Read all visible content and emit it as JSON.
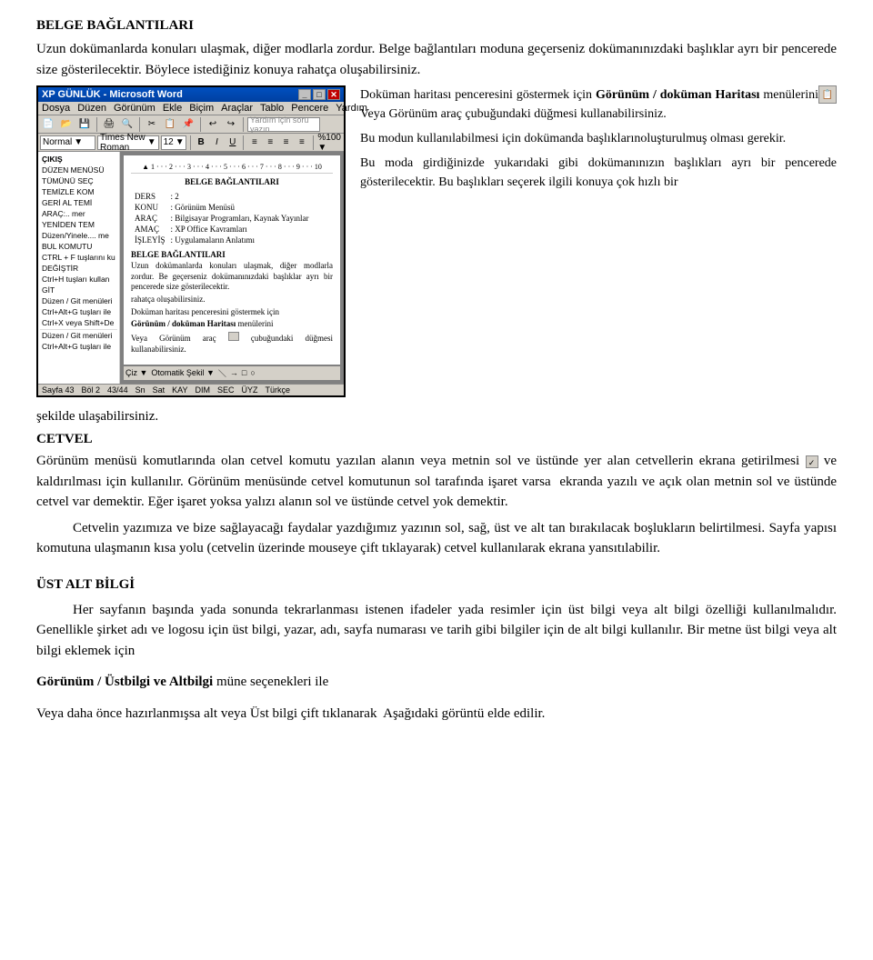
{
  "page": {
    "heading1": "BELGE BAĞLANTILARI",
    "para1": "Uzun dokümanlarda konuları ulaşmak, diğer modlarla zordur. Belge bağlantıları moduna geçerseniz dokümanınızdaki başlıklar ayrı bir pencerede size gösterilecektir. Böylece istediğiniz konuya rahatça oluşabilirsiniz.",
    "side_text": {
      "p1": "Doküman haritası penceresini göstermek için ",
      "p1_bold": "Görünüm / doküman Haritası",
      "p1_rest": " menülerini Veya Görünüm araç çubuğundaki düğmesi kullanabilirsiniz.",
      "p2": "Bu modun kullanılabilmesi için dokümanda başlıklarınoluşturulmuş olması gerekir.",
      "p3": "Bu moda girdiğinizde yukarıdaki gibi dokümanınızın başlıkları ayrı bir pencerede gösterilecektir. Bu başlıkları seçerek ilgili konuya çok hızlı bir",
      "after_two_col": "şekilde ulaşabilirsiniz."
    },
    "cetvel": {
      "heading": "CETVEL",
      "para1": "Görünüm menüsü komutlarında olan cetvel komutu yazılan alanın veya metnin sol ve üstünde yer alan cetvellerin ekrana getirilmesi",
      "icon_alt": "checkmark",
      "para1_rest": " ve kaldırılması için kullanılır. Görünüm menüsünde cetvel komutunun sol tarafında işaret varsa  ekranda yazılı ve açık olan metnin sol ve üstünde cetvel var demektir. Eğer işaret yoksa yalızı alanın sol ve üstünde cetvel yok demektir.",
      "indent_para": "Cetvelin yazımıza ve bize sağlayacağı faydalar yazdığımız yazının sol, sağ, üst ve alt tan bırakılacak boşlukların belirtilmesi. Sayfa yapısı komutuna ulaşmanın kısa yolu (cetvelin üzerinde mouseye çift tıklayarak) cetvel kullanılarak ekrana yansıtılabilir."
    },
    "ust_alt": {
      "heading": "ÜST ALT BİLGİ",
      "para1": "Her sayfanın başında yada sonunda tekrarlanması istenen ifadeler yada resimler için üst bilgi veya alt bilgi özelliği kullanılmalıdır. Genellikle şirket adı ve logosu için üst bilgi, yazar, adı, sayfa numarası ve tarih gibi bilgiler için de alt bilgi kullanılır. Bir metne üst bilgi veya alt bilgi eklemek için",
      "goruntum_line1": "Görünüm / Üstbilgi ve Altbilgi",
      "goruntum_line1_rest": " müne seçenekleri ile",
      "goruntum_line2": "Veya daha önce hazırlanmışsa alt veya Üst bilgi çift tıklanarak  Aşağıdaki görüntü elde edilir."
    },
    "word_window": {
      "title": "XP GÜNLÜK - Microsoft Word",
      "menu_items": [
        "Dosya",
        "Düzen",
        "Görünüm",
        "Ekle",
        "Biçim",
        "Araçlar",
        "Tablo",
        "Pencere",
        "Yardım"
      ],
      "search_placeholder": "Yardım için soru yazın",
      "style_value": "Normal",
      "font_value": "Times New Roman",
      "size_value": "12",
      "left_panel_items": [
        {
          "text": "ÇIKIŞ",
          "bold": true
        },
        {
          "text": "DÜZEN MENÜSÜ",
          "bold": false
        },
        {
          "text": "TÜMÜNÜ SEÇ",
          "bold": false
        },
        {
          "text": "TEMİZLE KOM",
          "bold": false
        },
        {
          "text": "GERİ AL TEMİ",
          "bold": false
        },
        {
          "text": "ARAÇ:.. mer",
          "bold": false
        },
        {
          "text": "YENİDEN TEM",
          "bold": false
        },
        {
          "text": "Düzen/Yinele.... me",
          "bold": false
        },
        {
          "text": "BUL KOMUTU",
          "bold": false
        },
        {
          "text": "CTRL + F tuşlarını ku",
          "bold": false
        },
        {
          "text": "DEĞİŞTİR",
          "bold": false
        },
        {
          "text": "Ctrl+H tuşları kullan",
          "bold": false
        },
        {
          "text": "GİT",
          "bold": false
        },
        {
          "text": "Düzen / Git menüleri",
          "bold": false
        },
        {
          "text": "Ctrl+Alt+G tuşları ile",
          "bold": false
        },
        {
          "text": "Ctrl+X veya Shift+De",
          "bold": false
        },
        {
          "text": "Düzen / Git menüleri",
          "bold": false
        },
        {
          "text": "Ctrl+Alt+G tuşları ile",
          "bold": false
        }
      ],
      "status_items": [
        "Sayfa 43",
        "Böl 2",
        "43/44",
        "Sn",
        "Sat",
        "KAY",
        "DIM",
        "SEC",
        "ÜYZ",
        "Türkçe"
      ]
    }
  }
}
